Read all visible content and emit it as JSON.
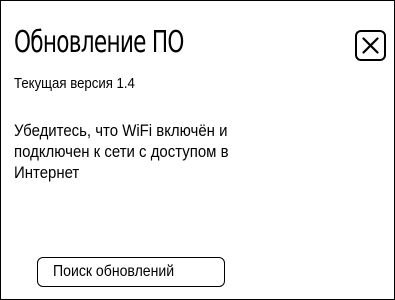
{
  "dialog": {
    "title": "Обновление ПО",
    "close_icon": "close-icon",
    "current_version": "Текущая версия 1.4",
    "message_lines": [
      "Убедитесь, что WiFi включён и",
      "подключен к сети с доступом в",
      "Интернет"
    ],
    "search_button_label": "Поиск обновлений"
  }
}
